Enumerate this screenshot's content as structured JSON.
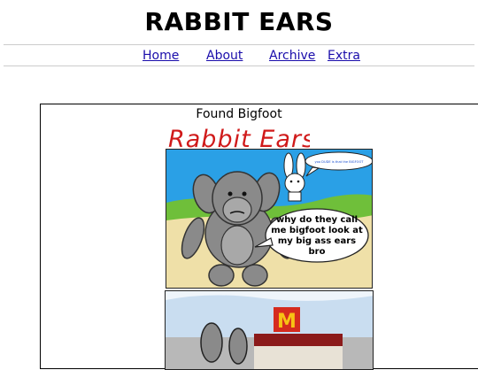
{
  "site": {
    "title": "RABBIT EARS"
  },
  "nav": {
    "items": [
      "Home",
      "About",
      "Archive",
      "Extra"
    ]
  },
  "comic": {
    "title": "Found Bigfoot",
    "logo_text": "Rabbit Ears",
    "small_bubble": "yoo DUDE is that the BIGFOOT",
    "big_bubble_lines": [
      "why do they call",
      "me bigfoot look at",
      "my big ass ears",
      "bro"
    ],
    "sign_letter": "M"
  },
  "colors": {
    "link": "#1a0dab",
    "sky": "#2aa0e6",
    "ground": "#efe0a8",
    "grass": "#6fbf3a",
    "gorilla": "#8a8a8a",
    "mcd_red": "#d52b1e",
    "mcd_yellow": "#f7c214"
  }
}
